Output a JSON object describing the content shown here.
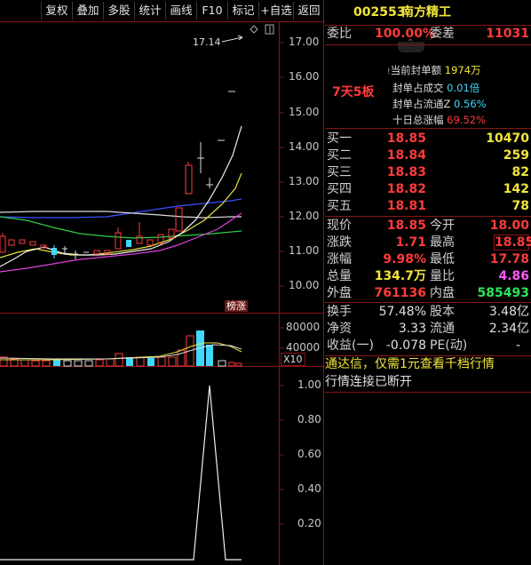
{
  "toolbar": {
    "items": [
      "复权",
      "叠加",
      "多股",
      "统计",
      "画线",
      "F10",
      "标记",
      "+自选",
      "返回"
    ]
  },
  "chart": {
    "max_label": "17.14",
    "price_ticks": [
      "17.00",
      "16.00",
      "15.00",
      "14.00",
      "13.00",
      "12.00",
      "11.00",
      "10.00"
    ],
    "limit_badge": "榜涨",
    "volume_ticks": [
      "80000",
      "40000"
    ],
    "volume_unit": "X10",
    "indicator_ticks": [
      "1.00",
      "0.80",
      "0.60",
      "0.40",
      "0.20"
    ]
  },
  "quote": {
    "code": "002553",
    "name": "南方精工",
    "weibi_label": "委比",
    "weibi_value": "100.00%",
    "weicha_label": "委差",
    "weicha_value": "11031",
    "streak": "7天5板",
    "seal_lines": [
      {
        "label": "当前封单额",
        "value": "1974万"
      },
      {
        "label": "封单占成交",
        "value": "0.01倍"
      },
      {
        "label": "封单占流通Z",
        "value": "0.56%"
      },
      {
        "label": "十日总涨幅",
        "value": "69.52%"
      }
    ],
    "bids": [
      {
        "label": "买一",
        "price": "18.85",
        "volume": "10470"
      },
      {
        "label": "买二",
        "price": "18.84",
        "volume": "259"
      },
      {
        "label": "买三",
        "price": "18.83",
        "volume": "82"
      },
      {
        "label": "买四",
        "price": "18.82",
        "volume": "142"
      },
      {
        "label": "买五",
        "price": "18.81",
        "volume": "78"
      }
    ],
    "stats": {
      "xianjia_label": "现价",
      "xianjia": "18.85",
      "jinkai_label": "今开",
      "jinkai": "18.00",
      "zhangdie_label": "涨跌",
      "zhangdie": "1.71",
      "zuigao_label": "最高",
      "zuigao": "18.85",
      "zhangfu_label": "涨幅",
      "zhangfu": "9.98%",
      "zuidi_label": "最低",
      "zuidi": "17.78",
      "zongliang_label": "总量",
      "zongliang": "134.7万",
      "liangbi_label": "量比",
      "liangbi": "4.86",
      "waipan_label": "外盘",
      "waipan": "761136",
      "neipan_label": "内盘",
      "neipan": "585493",
      "huanshou_label": "换手",
      "huanshou": "57.48%",
      "guben_label": "股本",
      "guben": "3.48亿",
      "jingzi_label": "净资",
      "jingzi": "3.33",
      "liutong_label": "流通",
      "liutong": "2.34亿",
      "shouyi_label": "收益(一)",
      "shouyi": "-0.078",
      "pe_label": "PE(动)",
      "pe": "-"
    },
    "notice": "通达信，仅需1元查看千档行情",
    "status": "行情连接已断开"
  },
  "colors": {
    "up": "#ff3b3b",
    "down": "#2fe45a",
    "cyan": "#40d8ff",
    "border": "#8a1414"
  }
}
